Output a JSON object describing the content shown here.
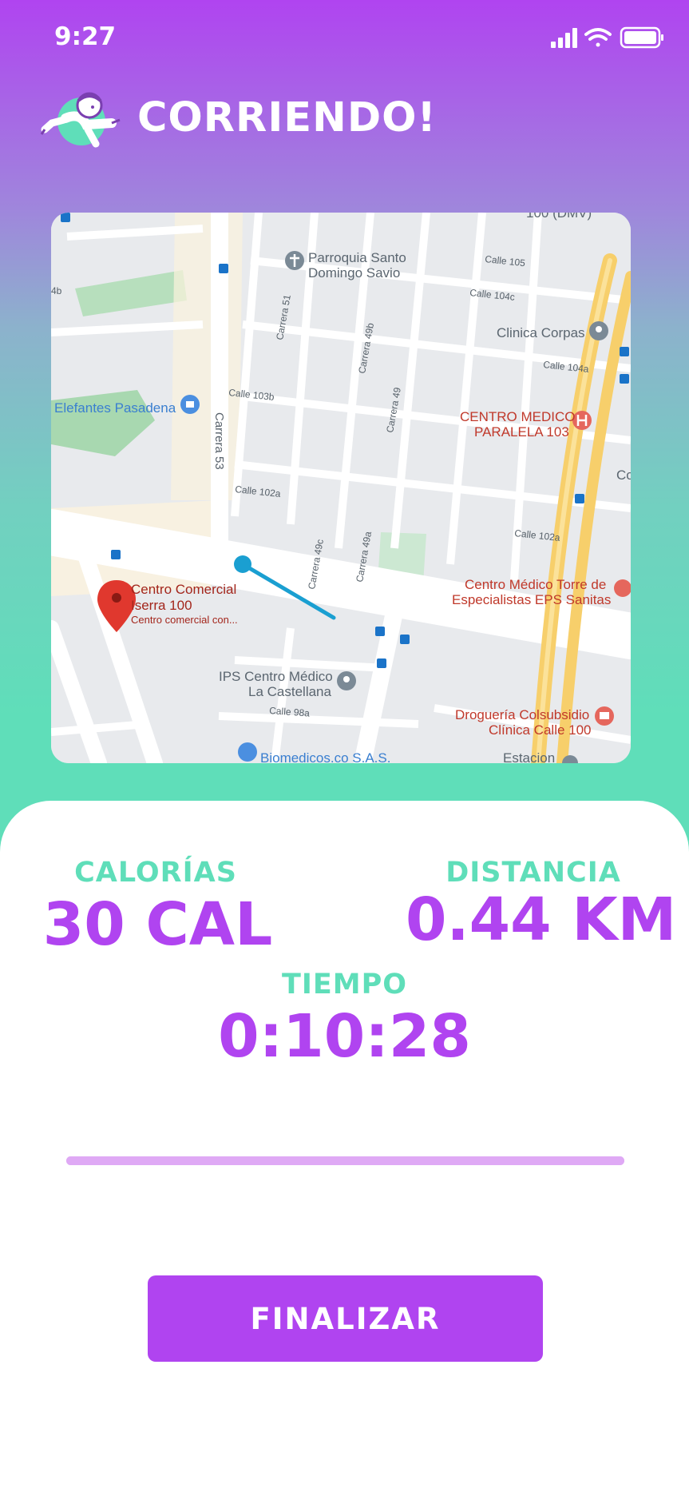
{
  "status_bar": {
    "time": "9:27"
  },
  "header": {
    "title": "CORRIENDO!"
  },
  "map": {
    "places": {
      "parroquia": [
        "Parroquia Santo",
        "Domingo Savio"
      ],
      "clinica_corpas": "Clinica Corpas",
      "elefantes": "Elefantes Pasadena",
      "centro_medico_paralela": [
        "CENTRO MEDICO",
        "PARALELA 103"
      ],
      "centro_comercial": [
        "Centro Comercial",
        "Iserra 100",
        "Centro comercial con..."
      ],
      "centro_medico_torre": [
        "Centro Médico Torre de",
        "Especialistas EPS Sanitas"
      ],
      "ips": [
        "IPS Centro Médico",
        "La Castellana"
      ],
      "drogueria": [
        "Droguería Colsubsidio",
        "Clínica Calle 100"
      ],
      "biomedicos": "Biomedicos.co S.A.S.",
      "estacion": "Estacion",
      "top_partial": "100 (DMV)",
      "right_partial": "Co"
    },
    "streets": {
      "calle105": "Calle 105",
      "calle104c": "Calle 104c",
      "calle104a": "Calle 104a",
      "calle103b": "Calle 103b",
      "calle102a_left": "Calle 102a",
      "calle102a_right": "Calle 102a",
      "calle98a": "Calle 98a",
      "carrera51": "Carrera 51",
      "carrera49b": "Carrera 49b",
      "carrera49": "Carrera 49",
      "carrera53": "Carrera 53",
      "carrera49c": "Carrera 49c",
      "carrera49a": "Carrera 49a",
      "s4b": "4b"
    }
  },
  "stats": {
    "calories": {
      "label": "CALORÍAS",
      "value": "30 CAL"
    },
    "distance": {
      "label": "DISTANCIA",
      "value": "0.44 KM"
    },
    "time": {
      "label": "TIEMPO",
      "value": "0:10:28"
    }
  },
  "progress": {
    "fraction": 1.0
  },
  "actions": {
    "finish_label": "FINALIZAR"
  },
  "colors": {
    "accent": "#b044f0",
    "secondary": "#5fdeb9",
    "route": "#1a9fd1"
  }
}
